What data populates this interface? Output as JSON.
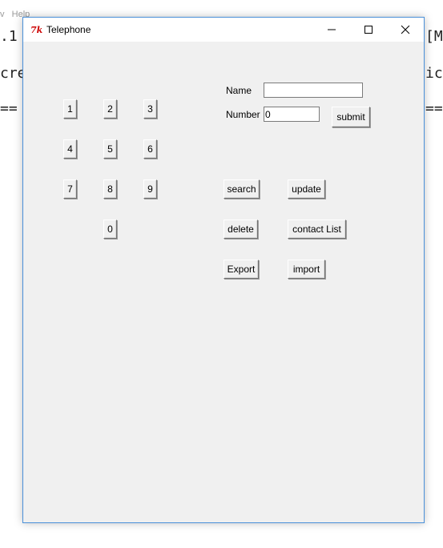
{
  "background": {
    "menu_text": "v   Help",
    "line1_left": ".1",
    "line1_right": "[M",
    "line2_left": "cre",
    "line2_right": "ic",
    "line3_left": "==",
    "line3_right": "=="
  },
  "window": {
    "title": "Telephone",
    "icon": "tk-feather-icon",
    "minimize_icon": "minimize-icon",
    "maximize_icon": "maximize-icon",
    "close_icon": "close-icon"
  },
  "keypad": {
    "keys": [
      "1",
      "2",
      "3",
      "4",
      "5",
      "6",
      "7",
      "8",
      "9",
      "0"
    ]
  },
  "form": {
    "name_label": "Name",
    "name_value": "",
    "number_label": "Number",
    "number_value": "0",
    "submit_label": "submit"
  },
  "actions": {
    "search_label": "search",
    "update_label": "update",
    "delete_label": "delete",
    "contact_list_label": "contact List",
    "export_label": "Export",
    "import_label": "import"
  },
  "colors": {
    "window_border": "#4a90d9",
    "window_bg": "#f0f0f0",
    "tk_icon_red": "#cc0000"
  }
}
